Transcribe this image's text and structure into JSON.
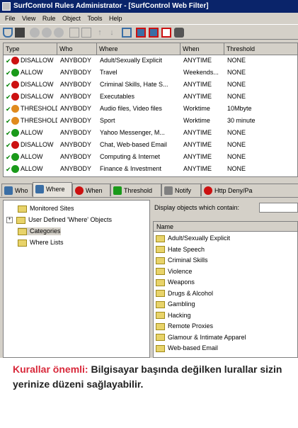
{
  "window": {
    "title": "SurfControl Rules Administrator - [SurfControl Web Filter]"
  },
  "menu": [
    "File",
    "View",
    "Rule",
    "Object",
    "Tools",
    "Help"
  ],
  "grid": {
    "columns": [
      "Type",
      "Who",
      "Where",
      "When",
      "Threshold"
    ],
    "rows": [
      {
        "type": "DISALLOW",
        "who": "ANYBODY",
        "where": "Adult/Sexually Explicit",
        "when": "ANYTIME",
        "threshold": "NONE",
        "color": "#cc1111"
      },
      {
        "type": "ALLOW",
        "who": "ANYBODY",
        "where": "Travel",
        "when": "Weekends...",
        "threshold": "NONE",
        "color": "#1a9a1a"
      },
      {
        "type": "DISALLOW",
        "who": "ANYBODY",
        "where": "Criminal Skills, Hate S...",
        "when": "ANYTIME",
        "threshold": "NONE",
        "color": "#cc1111"
      },
      {
        "type": "DISALLOW",
        "who": "ANYBODY",
        "where": "Executables",
        "when": "ANYTIME",
        "threshold": "NONE",
        "color": "#cc1111"
      },
      {
        "type": "THRESHOLD",
        "who": "ANYBODY",
        "where": "Audio files, Video files",
        "when": "Worktime",
        "threshold": "10Mbyte",
        "color": "#e08a1e"
      },
      {
        "type": "THRESHOLD",
        "who": "ANYBODY",
        "where": "Sport",
        "when": "Worktime",
        "threshold": "30 minute",
        "color": "#e08a1e"
      },
      {
        "type": "ALLOW",
        "who": "ANYBODY",
        "where": "Yahoo Messenger, M...",
        "when": "ANYTIME",
        "threshold": "NONE",
        "color": "#1a9a1a"
      },
      {
        "type": "DISALLOW",
        "who": "ANYBODY",
        "where": "Chat, Web-based Email",
        "when": "ANYTIME",
        "threshold": "NONE",
        "color": "#cc1111"
      },
      {
        "type": "ALLOW",
        "who": "ANYBODY",
        "where": "Computing & Internet",
        "when": "ANYTIME",
        "threshold": "NONE",
        "color": "#1a9a1a"
      },
      {
        "type": "ALLOW",
        "who": "ANYBODY",
        "where": "Finance & Investment",
        "when": "ANYTIME",
        "threshold": "NONE",
        "color": "#1a9a1a"
      }
    ]
  },
  "tabs": [
    {
      "label": "Who",
      "color": "#3a6ea5"
    },
    {
      "label": "Where",
      "color": "#3a6ea5"
    },
    {
      "label": "When",
      "color": "#cc1111"
    },
    {
      "label": "Threshold",
      "color": "#1a9a1a"
    },
    {
      "label": "Notify",
      "color": "#808080"
    },
    {
      "label": "Http Deny/Pa",
      "color": "#cc1111"
    }
  ],
  "tree": {
    "items": [
      "Monitored Sites",
      "User Defined 'Where' Objects",
      "Categories",
      "Where Lists"
    ]
  },
  "filter": {
    "label": "Display objects which contain:"
  },
  "list": {
    "header": "Name",
    "items": [
      "Adult/Sexually Explicit",
      "Hate Speech",
      "Criminal Skills",
      "Violence",
      "Weapons",
      "Drugs & Alcohol",
      "Gambling",
      "Hacking",
      "Remote Proxies",
      "Glamour & Intimate Apparel",
      "Web-based Email"
    ]
  },
  "caption": {
    "lead": "Kurallar önemli:",
    "text": " Bilgisayar başında değilken lurallar sizin yerinize düzeni sağlayabilir."
  }
}
